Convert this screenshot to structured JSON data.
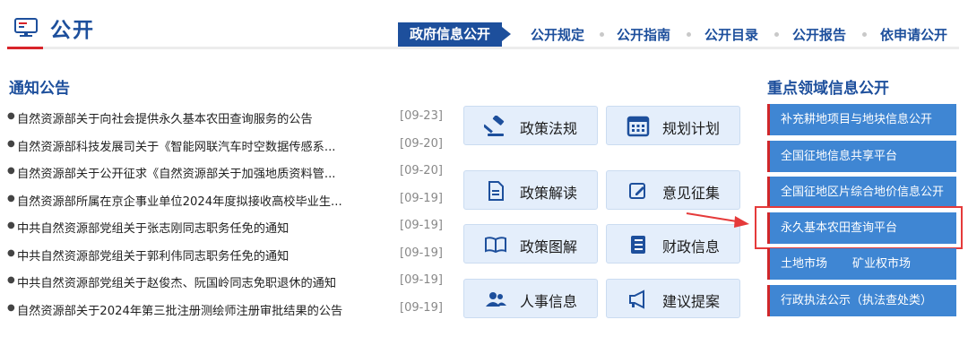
{
  "header": {
    "title": "公开",
    "nav": {
      "active": "政府信息公开",
      "items": [
        "公开规定",
        "公开指南",
        "公开目录",
        "公开报告",
        "依申请公开"
      ]
    }
  },
  "notices": {
    "title": "通知公告",
    "items": [
      {
        "text": "自然资源部关于向社会提供永久基本农田查询服务的公告",
        "date": "[09-23]"
      },
      {
        "text": "自然资源部科技发展司关于《智能网联汽车时空数据传感系...",
        "date": "[09-20]"
      },
      {
        "text": "自然资源部关于公开征求《自然资源部关于加强地质资料管...",
        "date": "[09-20]"
      },
      {
        "text": "自然资源部所属在京企事业单位2024年度拟接收高校毕业生...",
        "date": "[09-19]"
      },
      {
        "text": "中共自然资源部党组关于张志刚同志职务任免的通知",
        "date": "[09-19]"
      },
      {
        "text": "中共自然资源部党组关于郭利伟同志职务任免的通知",
        "date": "[09-19]"
      },
      {
        "text": "中共自然资源部党组关于赵俊杰、阮国岭同志免职退休的通知",
        "date": "[09-19]"
      },
      {
        "text": "自然资源部关于2024年第三批注册测绘师注册审批结果的公告",
        "date": "[09-19]"
      }
    ]
  },
  "services": [
    {
      "label": "政策法规",
      "icon": "gavel-icon"
    },
    {
      "label": "规划计划",
      "icon": "calendar-icon"
    },
    {
      "label": "政策解读",
      "icon": "document-icon"
    },
    {
      "label": "意见征集",
      "icon": "edit-icon"
    },
    {
      "label": "政策图解",
      "icon": "book-icon"
    },
    {
      "label": "财政信息",
      "icon": "ledger-icon"
    },
    {
      "label": "人事信息",
      "icon": "people-icon"
    },
    {
      "label": "建议提案",
      "icon": "megaphone-icon"
    }
  ],
  "focus": {
    "title": "重点领域信息公开",
    "items": [
      "补充耕地项目与地块信息公开",
      "全国征地信息共享平台",
      "全国征地区片综合地价信息公开",
      "永久基本农田查询平台"
    ],
    "market": [
      "土地市场",
      "矿业权市场"
    ],
    "enforcement": "行政执法公示（执法查处类）"
  },
  "colors": {
    "brand": "#1d4f9c",
    "accent_red": "#d8242a",
    "button_blue": "#3f86d3",
    "service_bg": "#e4eefb"
  }
}
